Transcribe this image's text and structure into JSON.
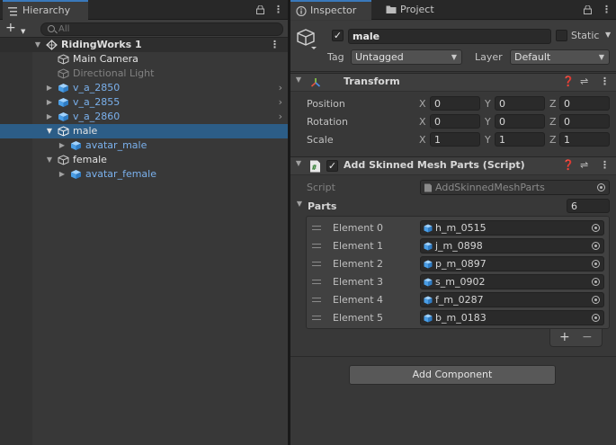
{
  "hierarchy": {
    "tab_label": "Hierarchy",
    "search_placeholder": "All",
    "scene_name": "RidingWorks 1",
    "items": [
      {
        "label": "Main Camera"
      },
      {
        "label": "Directional Light"
      },
      {
        "label": "v_a_2850"
      },
      {
        "label": "v_a_2855"
      },
      {
        "label": "v_a_2860"
      },
      {
        "label": "male"
      },
      {
        "label": "avatar_male"
      },
      {
        "label": "female"
      },
      {
        "label": "avatar_female"
      }
    ]
  },
  "inspector": {
    "tab_label": "Inspector",
    "project_tab_label": "Project",
    "object_name": "male",
    "static_label": "Static",
    "tag_label": "Tag",
    "tag_value": "Untagged",
    "layer_label": "Layer",
    "layer_value": "Default",
    "transform": {
      "title": "Transform",
      "position_label": "Position",
      "rotation_label": "Rotation",
      "scale_label": "Scale",
      "x": "X",
      "y": "Y",
      "z": "Z",
      "position": [
        "0",
        "0",
        "0"
      ],
      "rotation": [
        "0",
        "0",
        "0"
      ],
      "scale": [
        "1",
        "1",
        "1"
      ]
    },
    "script_component": {
      "title": "Add Skinned Mesh Parts (Script)",
      "script_label": "Script",
      "script_value": "AddSkinnedMeshParts",
      "parts_label": "Parts",
      "parts_count": "6",
      "elements": [
        {
          "label": "Element 0",
          "value": "h_m_0515"
        },
        {
          "label": "Element 1",
          "value": "j_m_0898"
        },
        {
          "label": "Element 2",
          "value": "p_m_0897"
        },
        {
          "label": "Element 3",
          "value": "s_m_0902"
        },
        {
          "label": "Element 4",
          "value": "f_m_0287"
        },
        {
          "label": "Element 5",
          "value": "b_m_0183"
        }
      ],
      "add_symbol": "+",
      "remove_symbol": "−"
    },
    "add_component_label": "Add Component"
  },
  "colors": {
    "selection": "#2c5d87",
    "prefab_blue": "#7ab0ec",
    "panel_bg": "#383838",
    "tab_accent": "#3a79bb"
  }
}
